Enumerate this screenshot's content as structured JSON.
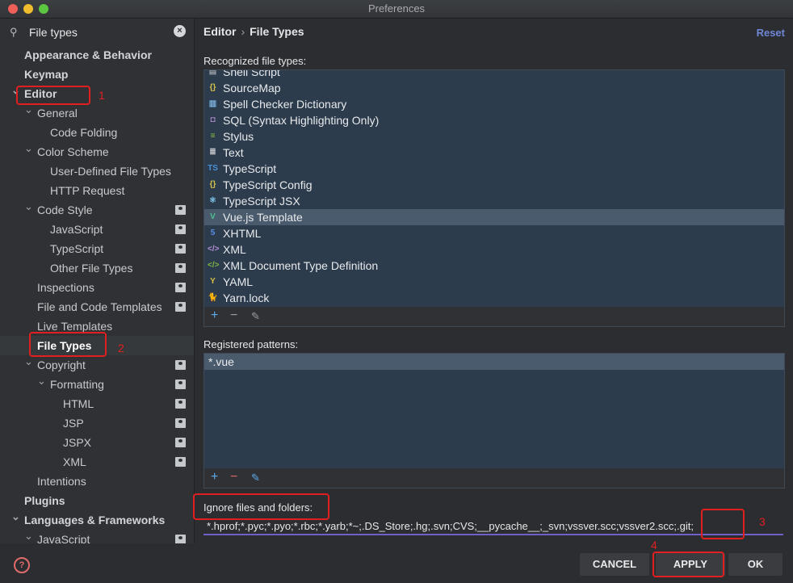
{
  "window": {
    "title": "Preferences"
  },
  "search": {
    "value": "File types",
    "placeholder": ""
  },
  "tree": [
    {
      "label": "Appearance & Behavior",
      "level": 0,
      "bold": true,
      "arrow": ""
    },
    {
      "label": "Keymap",
      "level": 0,
      "bold": true,
      "arrow": ""
    },
    {
      "label": "Editor",
      "level": 0,
      "bold": true,
      "arrow": "down"
    },
    {
      "label": "General",
      "level": 1,
      "arrow": "down"
    },
    {
      "label": "Code Folding",
      "level": 2
    },
    {
      "label": "Color Scheme",
      "level": 1,
      "arrow": "down"
    },
    {
      "label": "User-Defined File Types",
      "level": 2
    },
    {
      "label": "HTTP Request",
      "level": 2
    },
    {
      "label": "Code Style",
      "level": 1,
      "arrow": "down",
      "project": true
    },
    {
      "label": "JavaScript",
      "level": 2,
      "project": true
    },
    {
      "label": "TypeScript",
      "level": 2,
      "project": true
    },
    {
      "label": "Other File Types",
      "level": 2,
      "project": true
    },
    {
      "label": "Inspections",
      "level": 1,
      "project": true
    },
    {
      "label": "File and Code Templates",
      "level": 1,
      "project": true
    },
    {
      "label": "Live Templates",
      "level": 1
    },
    {
      "label": "File Types",
      "level": 1,
      "selected": true
    },
    {
      "label": "Copyright",
      "level": 1,
      "arrow": "down",
      "project": true
    },
    {
      "label": "Formatting",
      "level": 2,
      "arrow": "down",
      "project": true
    },
    {
      "label": "HTML",
      "level": 3,
      "project": true
    },
    {
      "label": "JSP",
      "level": 3,
      "project": true
    },
    {
      "label": "JSPX",
      "level": 3,
      "project": true
    },
    {
      "label": "XML",
      "level": 3,
      "project": true
    },
    {
      "label": "Intentions",
      "level": 1
    },
    {
      "label": "Plugins",
      "level": 0,
      "bold": true
    },
    {
      "label": "Languages & Frameworks",
      "level": 0,
      "bold": true,
      "arrow": "down"
    },
    {
      "label": "JavaScript",
      "level": 1,
      "arrow": "down",
      "project": true
    }
  ],
  "breadcrumb": {
    "parent": "Editor",
    "sep": "›",
    "current": "File Types"
  },
  "reset_label": "Reset",
  "recognized_label": "Recognized file types:",
  "file_types": [
    {
      "label": "Shell Script",
      "icon": "shell-icon",
      "glyph": "▤",
      "color": "#9aa0a6"
    },
    {
      "label": "SourceMap",
      "icon": "json-icon",
      "glyph": "{}",
      "color": "#d5c04a"
    },
    {
      "label": "Spell Checker Dictionary",
      "icon": "dictionary-icon",
      "glyph": "▥",
      "color": "#7fb3e0"
    },
    {
      "label": "SQL (Syntax Highlighting Only)",
      "icon": "sql-icon",
      "glyph": "◘",
      "color": "#b58ed6"
    },
    {
      "label": "Stylus",
      "icon": "stylus-icon",
      "glyph": "≡",
      "color": "#8bc34a"
    },
    {
      "label": "Text",
      "icon": "text-icon",
      "glyph": "≣",
      "color": "#c8cacd"
    },
    {
      "label": "TypeScript",
      "icon": "typescript-icon",
      "glyph": "TS",
      "color": "#4a8fd8"
    },
    {
      "label": "TypeScript Config",
      "icon": "json-icon",
      "glyph": "{}",
      "color": "#d5c04a"
    },
    {
      "label": "TypeScript JSX",
      "icon": "react-icon",
      "glyph": "⚛",
      "color": "#7fc4e8"
    },
    {
      "label": "Vue.js Template",
      "icon": "vue-icon",
      "glyph": "V",
      "color": "#4fc08d",
      "selected": true
    },
    {
      "label": "XHTML",
      "icon": "html5-icon",
      "glyph": "5",
      "color": "#5b8ee6"
    },
    {
      "label": "XML",
      "icon": "xml-icon",
      "glyph": "</>",
      "color": "#b58ed6"
    },
    {
      "label": "XML Document Type Definition",
      "icon": "dtd-icon",
      "glyph": "</>",
      "color": "#7cb342"
    },
    {
      "label": "YAML",
      "icon": "yaml-icon",
      "glyph": "Y",
      "color": "#d5c04a"
    },
    {
      "label": "Yarn.lock",
      "icon": "yarn-icon",
      "glyph": "🐈",
      "color": "#6aa8d8"
    }
  ],
  "patterns_label": "Registered patterns:",
  "patterns": [
    "*.vue"
  ],
  "ignore_label": "Ignore files and folders:",
  "ignore_value": "*.hprof;*.pyc;*.pyo;*.rbc;*.yarb;*~;.DS_Store;.hg;.svn;CVS;__pycache__;_svn;vssver.scc;vssver2.scc;.git;",
  "buttons": {
    "cancel": "CANCEL",
    "apply": "APPLY",
    "ok": "OK"
  },
  "annotations": [
    "1",
    "2",
    "3",
    "4"
  ],
  "colors": {
    "annotation": "#e02020",
    "accent": "#6f5fc9",
    "list_bg": "#2c3c4d",
    "reset": "#6e86d6"
  }
}
